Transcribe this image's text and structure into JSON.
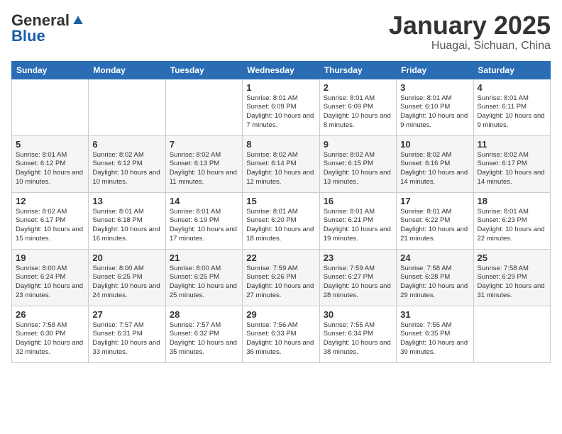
{
  "logo": {
    "general": "General",
    "blue": "Blue"
  },
  "header": {
    "month": "January 2025",
    "location": "Huagai, Sichuan, China"
  },
  "weekdays": [
    "Sunday",
    "Monday",
    "Tuesday",
    "Wednesday",
    "Thursday",
    "Friday",
    "Saturday"
  ],
  "weeks": [
    [
      {
        "day": "",
        "detail": ""
      },
      {
        "day": "",
        "detail": ""
      },
      {
        "day": "",
        "detail": ""
      },
      {
        "day": "1",
        "detail": "Sunrise: 8:01 AM\nSunset: 6:09 PM\nDaylight: 10 hours\nand 7 minutes."
      },
      {
        "day": "2",
        "detail": "Sunrise: 8:01 AM\nSunset: 6:09 PM\nDaylight: 10 hours\nand 8 minutes."
      },
      {
        "day": "3",
        "detail": "Sunrise: 8:01 AM\nSunset: 6:10 PM\nDaylight: 10 hours\nand 9 minutes."
      },
      {
        "day": "4",
        "detail": "Sunrise: 8:01 AM\nSunset: 6:11 PM\nDaylight: 10 hours\nand 9 minutes."
      }
    ],
    [
      {
        "day": "5",
        "detail": "Sunrise: 8:01 AM\nSunset: 6:12 PM\nDaylight: 10 hours\nand 10 minutes."
      },
      {
        "day": "6",
        "detail": "Sunrise: 8:02 AM\nSunset: 6:12 PM\nDaylight: 10 hours\nand 10 minutes."
      },
      {
        "day": "7",
        "detail": "Sunrise: 8:02 AM\nSunset: 6:13 PM\nDaylight: 10 hours\nand 11 minutes."
      },
      {
        "day": "8",
        "detail": "Sunrise: 8:02 AM\nSunset: 6:14 PM\nDaylight: 10 hours\nand 12 minutes."
      },
      {
        "day": "9",
        "detail": "Sunrise: 8:02 AM\nSunset: 6:15 PM\nDaylight: 10 hours\nand 13 minutes."
      },
      {
        "day": "10",
        "detail": "Sunrise: 8:02 AM\nSunset: 6:16 PM\nDaylight: 10 hours\nand 14 minutes."
      },
      {
        "day": "11",
        "detail": "Sunrise: 8:02 AM\nSunset: 6:17 PM\nDaylight: 10 hours\nand 14 minutes."
      }
    ],
    [
      {
        "day": "12",
        "detail": "Sunrise: 8:02 AM\nSunset: 6:17 PM\nDaylight: 10 hours\nand 15 minutes."
      },
      {
        "day": "13",
        "detail": "Sunrise: 8:01 AM\nSunset: 6:18 PM\nDaylight: 10 hours\nand 16 minutes."
      },
      {
        "day": "14",
        "detail": "Sunrise: 8:01 AM\nSunset: 6:19 PM\nDaylight: 10 hours\nand 17 minutes."
      },
      {
        "day": "15",
        "detail": "Sunrise: 8:01 AM\nSunset: 6:20 PM\nDaylight: 10 hours\nand 18 minutes."
      },
      {
        "day": "16",
        "detail": "Sunrise: 8:01 AM\nSunset: 6:21 PM\nDaylight: 10 hours\nand 19 minutes."
      },
      {
        "day": "17",
        "detail": "Sunrise: 8:01 AM\nSunset: 6:22 PM\nDaylight: 10 hours\nand 21 minutes."
      },
      {
        "day": "18",
        "detail": "Sunrise: 8:01 AM\nSunset: 6:23 PM\nDaylight: 10 hours\nand 22 minutes."
      }
    ],
    [
      {
        "day": "19",
        "detail": "Sunrise: 8:00 AM\nSunset: 6:24 PM\nDaylight: 10 hours\nand 23 minutes."
      },
      {
        "day": "20",
        "detail": "Sunrise: 8:00 AM\nSunset: 6:25 PM\nDaylight: 10 hours\nand 24 minutes."
      },
      {
        "day": "21",
        "detail": "Sunrise: 8:00 AM\nSunset: 6:25 PM\nDaylight: 10 hours\nand 25 minutes."
      },
      {
        "day": "22",
        "detail": "Sunrise: 7:59 AM\nSunset: 6:26 PM\nDaylight: 10 hours\nand 27 minutes."
      },
      {
        "day": "23",
        "detail": "Sunrise: 7:59 AM\nSunset: 6:27 PM\nDaylight: 10 hours\nand 28 minutes."
      },
      {
        "day": "24",
        "detail": "Sunrise: 7:58 AM\nSunset: 6:28 PM\nDaylight: 10 hours\nand 29 minutes."
      },
      {
        "day": "25",
        "detail": "Sunrise: 7:58 AM\nSunset: 6:29 PM\nDaylight: 10 hours\nand 31 minutes."
      }
    ],
    [
      {
        "day": "26",
        "detail": "Sunrise: 7:58 AM\nSunset: 6:30 PM\nDaylight: 10 hours\nand 32 minutes."
      },
      {
        "day": "27",
        "detail": "Sunrise: 7:57 AM\nSunset: 6:31 PM\nDaylight: 10 hours\nand 33 minutes."
      },
      {
        "day": "28",
        "detail": "Sunrise: 7:57 AM\nSunset: 6:32 PM\nDaylight: 10 hours\nand 35 minutes."
      },
      {
        "day": "29",
        "detail": "Sunrise: 7:56 AM\nSunset: 6:33 PM\nDaylight: 10 hours\nand 36 minutes."
      },
      {
        "day": "30",
        "detail": "Sunrise: 7:55 AM\nSunset: 6:34 PM\nDaylight: 10 hours\nand 38 minutes."
      },
      {
        "day": "31",
        "detail": "Sunrise: 7:55 AM\nSunset: 6:35 PM\nDaylight: 10 hours\nand 39 minutes."
      },
      {
        "day": "",
        "detail": ""
      }
    ]
  ]
}
